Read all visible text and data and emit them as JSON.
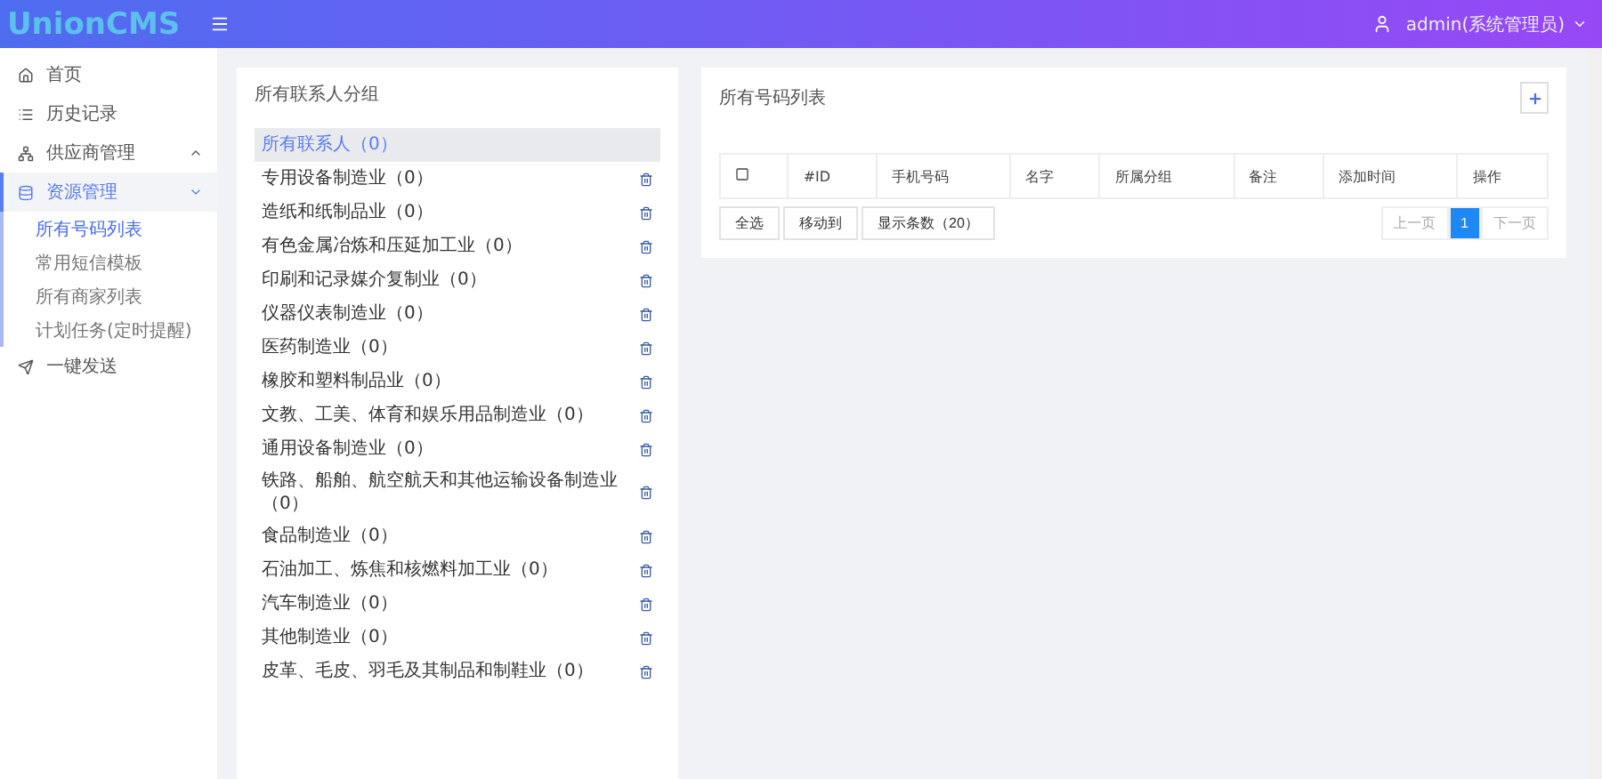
{
  "header": {
    "logo": "UnionCMS",
    "user": "admin(系统管理员)"
  },
  "sidebar": {
    "items": [
      {
        "label": "首页",
        "selected": false
      },
      {
        "label": "历史记录",
        "selected": false
      },
      {
        "label": "供应商管理",
        "selected": false,
        "expanded": false
      },
      {
        "label": "资源管理",
        "selected": true,
        "expanded": true,
        "children": [
          {
            "label": "所有号码列表",
            "selected": true
          },
          {
            "label": "常用短信模板",
            "selected": false
          },
          {
            "label": "所有商家列表",
            "selected": false
          },
          {
            "label": "计划任务(定时提醒)",
            "selected": false
          }
        ]
      },
      {
        "label": "一键发送",
        "selected": false
      }
    ]
  },
  "groups": {
    "title": "所有联系人分组",
    "items": [
      {
        "label": "所有联系人（0）",
        "selected": true,
        "deletable": false
      },
      {
        "label": "专用设备制造业（0）",
        "selected": false,
        "deletable": true
      },
      {
        "label": "造纸和纸制品业（0）",
        "selected": false,
        "deletable": true
      },
      {
        "label": "有色金属冶炼和压延加工业（0）",
        "selected": false,
        "deletable": true
      },
      {
        "label": "印刷和记录媒介复制业（0）",
        "selected": false,
        "deletable": true
      },
      {
        "label": "仪器仪表制造业（0）",
        "selected": false,
        "deletable": true
      },
      {
        "label": "医药制造业（0）",
        "selected": false,
        "deletable": true
      },
      {
        "label": "橡胶和塑料制品业（0）",
        "selected": false,
        "deletable": true
      },
      {
        "label": "文教、工美、体育和娱乐用品制造业（0）",
        "selected": false,
        "deletable": true
      },
      {
        "label": "通用设备制造业（0）",
        "selected": false,
        "deletable": true
      },
      {
        "label": "铁路、船舶、航空航天和其他运输设备制造业（0）",
        "selected": false,
        "deletable": true
      },
      {
        "label": "食品制造业（0）",
        "selected": false,
        "deletable": true
      },
      {
        "label": "石油加工、炼焦和核燃料加工业（0）",
        "selected": false,
        "deletable": true
      },
      {
        "label": "汽车制造业（0）",
        "selected": false,
        "deletable": true
      },
      {
        "label": "其他制造业（0）",
        "selected": false,
        "deletable": true
      },
      {
        "label": "皮革、毛皮、羽毛及其制品和制鞋业（0）",
        "selected": false,
        "deletable": true
      }
    ]
  },
  "numbers": {
    "title": "所有号码列表",
    "table": {
      "columns": [
        "#ID",
        "手机号码",
        "名字",
        "所属分组",
        "备注",
        "添加时间",
        "操作"
      ],
      "select_all_checked": false
    },
    "buttons": [
      "全选",
      "移动到",
      "显示条数（20）"
    ],
    "pagination": {
      "prev": "上一页",
      "pages": [
        {
          "label": "1",
          "selected": true
        }
      ],
      "next": "下一页"
    }
  }
}
